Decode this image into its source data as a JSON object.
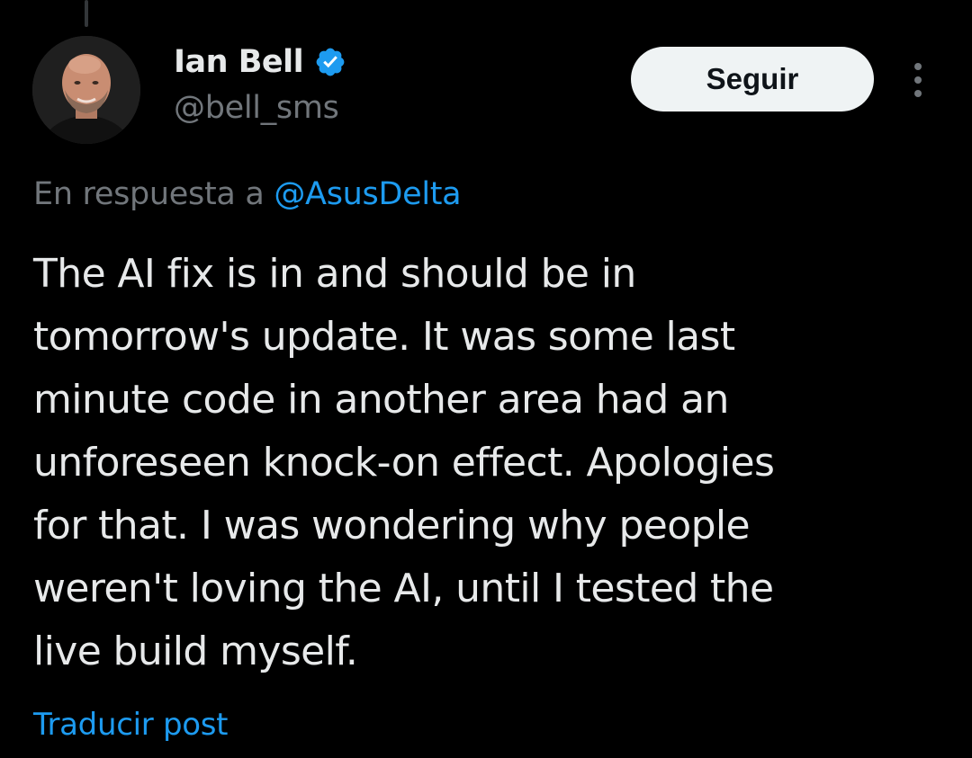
{
  "author": {
    "display_name": "Ian Bell",
    "handle": "@bell_sms",
    "verified_icon": "verified-badge-icon",
    "avatar_icon": "profile-photo"
  },
  "actions": {
    "follow_label": "Seguir",
    "more_icon": "more-vertical-icon"
  },
  "reply": {
    "prefix": "En respuesta a ",
    "mention": "@AsusDelta"
  },
  "tweet": {
    "lines": [
      "The AI fix is in and should be in",
      "tomorrow's update. It was some last",
      "minute code in another area had an",
      "unforeseen knock-on effect. Apologies",
      "for that. I was wondering why people",
      "weren't loving the AI, until I tested the",
      "live build myself."
    ]
  },
  "translate_label": "Traducir post",
  "colors": {
    "background": "#000000",
    "primary_text": "#e7e9ea",
    "secondary_text": "#71767b",
    "link": "#1d9bf0",
    "follow_button_bg": "#eff3f4",
    "verified": "#1d9bf0"
  }
}
